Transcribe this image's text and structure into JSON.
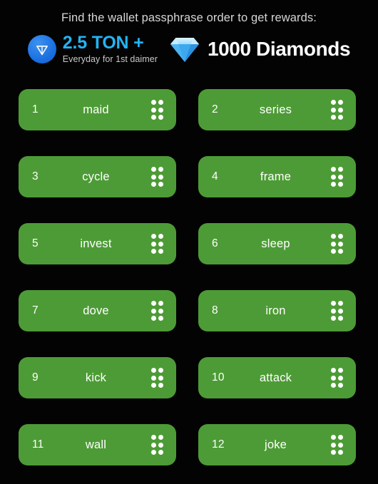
{
  "header": {
    "title": "Find the wallet passphrase order to get rewards:",
    "rewards": {
      "ton": {
        "icon": "ton-logo-icon",
        "amount": "2.5 TON +",
        "subtitle": "Everyday for 1st daimer",
        "amount_color": "#23b4f4",
        "logo_color": "#1a6fe0"
      },
      "diamond": {
        "icon": "diamond-gem-icon",
        "label": "1000 Diamonds",
        "label_color": "#ffffff",
        "gem_color": "#3fa9f5"
      }
    }
  },
  "theme": {
    "background": "#030303",
    "card_background": "#4d9b36",
    "card_text": "#ffffff",
    "title_color": "#d6d6d6"
  },
  "word_grid": {
    "handle_icon": "drag-handle-icon",
    "cards": [
      {
        "index": "1",
        "word": "maid"
      },
      {
        "index": "2",
        "word": "series"
      },
      {
        "index": "3",
        "word": "cycle"
      },
      {
        "index": "4",
        "word": "frame"
      },
      {
        "index": "5",
        "word": "invest"
      },
      {
        "index": "6",
        "word": "sleep"
      },
      {
        "index": "7",
        "word": "dove"
      },
      {
        "index": "8",
        "word": "iron"
      },
      {
        "index": "9",
        "word": "kick"
      },
      {
        "index": "10",
        "word": "attack"
      },
      {
        "index": "11",
        "word": "wall"
      },
      {
        "index": "12",
        "word": "joke"
      }
    ]
  }
}
